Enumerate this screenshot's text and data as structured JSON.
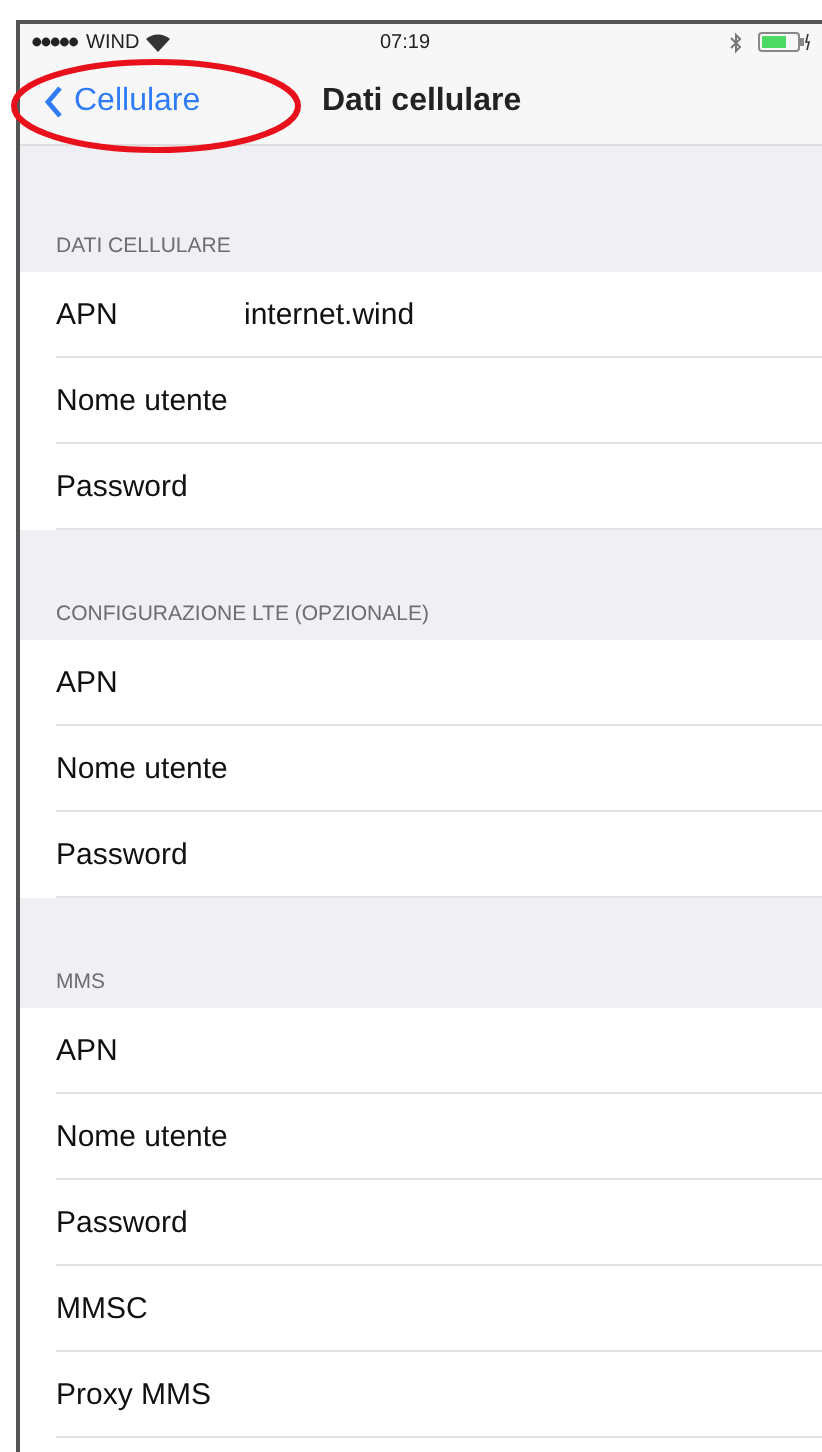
{
  "status_bar": {
    "carrier": "WIND",
    "time": "07:19"
  },
  "nav": {
    "back": {
      "label": "Cellulare",
      "highlighted": true
    },
    "title": "Dati cellulare"
  },
  "sections": [
    {
      "header": "DATI CELLULARE",
      "rows": [
        {
          "label": "APN",
          "value": "internet.wind"
        },
        {
          "label": "Nome utente"
        },
        {
          "label": "Password"
        }
      ]
    },
    {
      "header": "CONFIGURAZIONE LTE (OPZIONALE)",
      "rows": [
        {
          "label": "APN"
        },
        {
          "label": "Nome utente"
        },
        {
          "label": "Password"
        }
      ]
    },
    {
      "header": "MMS",
      "rows": [
        {
          "label": "APN"
        },
        {
          "label": "Nome utente"
        },
        {
          "label": "Password"
        },
        {
          "label": "MMSC"
        },
        {
          "label": "Proxy MMS"
        }
      ]
    }
  ]
}
